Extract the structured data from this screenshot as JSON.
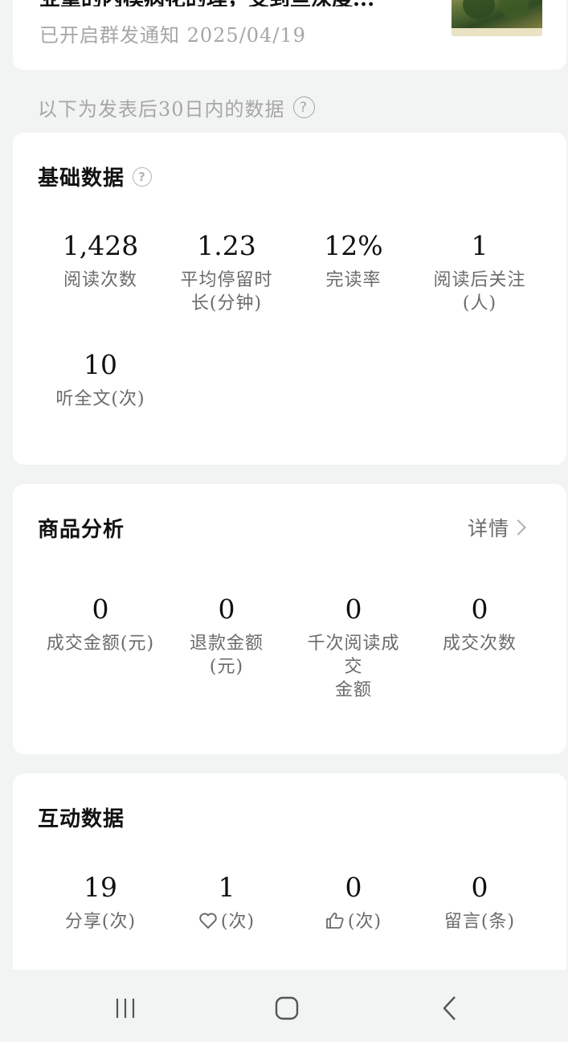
{
  "article": {
    "title": "业重的内模病花的理，受到些深度...",
    "meta": "已开启群发通知 2025/04/19"
  },
  "note": {
    "text": "以下为发表后30日内的数据"
  },
  "basic": {
    "title": "基础数据",
    "metrics": [
      {
        "value": "1,428",
        "label_line1": "阅读次数",
        "label_line2": ""
      },
      {
        "value": "1.23",
        "label_line1": "平均停留时",
        "label_line2": "长(分钟)"
      },
      {
        "value": "12%",
        "label_line1": "完读率",
        "label_line2": ""
      },
      {
        "value": "1",
        "label_line1": "阅读后关注",
        "label_line2": "(人)"
      },
      {
        "value": "10",
        "label_line1": "听全文(次)",
        "label_line2": ""
      }
    ]
  },
  "goods": {
    "title": "商品分析",
    "detail_label": "详情",
    "metrics": [
      {
        "value": "0",
        "label_line1": "成交金额(元)",
        "label_line2": "",
        "label_line3": ""
      },
      {
        "value": "0",
        "label_line1": "退款金额",
        "label_line2": "(元)",
        "label_line3": ""
      },
      {
        "value": "0",
        "label_line1": "千次阅读成",
        "label_line2": "交",
        "label_line3": "金额"
      },
      {
        "value": "0",
        "label_line1": "成交次数",
        "label_line2": "",
        "label_line3": ""
      }
    ]
  },
  "interact": {
    "title": "互动数据",
    "metrics": [
      {
        "value": "19",
        "label": "分享(次)",
        "icon": ""
      },
      {
        "value": "1",
        "label": "(次)",
        "icon": "heart-icon"
      },
      {
        "value": "0",
        "label": "(次)",
        "icon": "thumbs-up-icon"
      },
      {
        "value": "0",
        "label": "留言(条)",
        "icon": ""
      }
    ]
  },
  "colors": {
    "background": "#f2f3f3",
    "card": "#ffffff",
    "muted_text": "#a6a6a6",
    "label_text": "#6b6b6b"
  },
  "navbar": {
    "icons": [
      "recent-apps-icon",
      "home-icon",
      "back-icon"
    ]
  }
}
